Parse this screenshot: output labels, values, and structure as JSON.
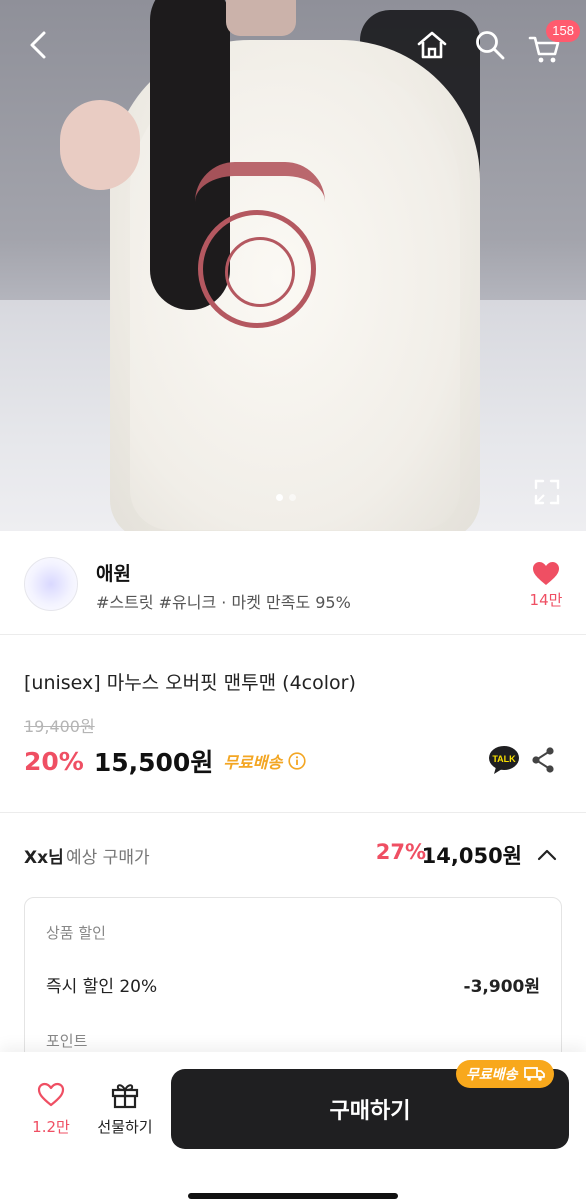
{
  "header": {
    "cart_count": "158"
  },
  "hero": {
    "image_count": 2,
    "active_index": 1
  },
  "shop": {
    "name": "애원",
    "tags": "#스트릿 #유니크 · 마켓 만족도 95%",
    "like_count": "14만"
  },
  "product": {
    "title": "[unisex] 마누스 오버핏 맨투맨 (4color)",
    "original_price": "19,400원",
    "discount": "20%",
    "price": "15,500원",
    "free_shipping": "무료배송"
  },
  "expected": {
    "user": "Xx님",
    "label": "예상 구매가",
    "discount": "27%",
    "price": "14,050원"
  },
  "detail": {
    "section_product_discount": "상품 할인",
    "instant_discount_label": "즉시 할인 20%",
    "instant_discount_value": "-3,900원",
    "section_points": "포인트"
  },
  "bottom": {
    "wish_count": "1.2만",
    "gift_label": "선물하기",
    "buy_label": "구매하기",
    "ship_badge": "무료배송"
  },
  "colors": {
    "accent_pink": "#ef4f63",
    "shipping_orange": "#f3a623",
    "buy_button": "#1f1f21"
  }
}
